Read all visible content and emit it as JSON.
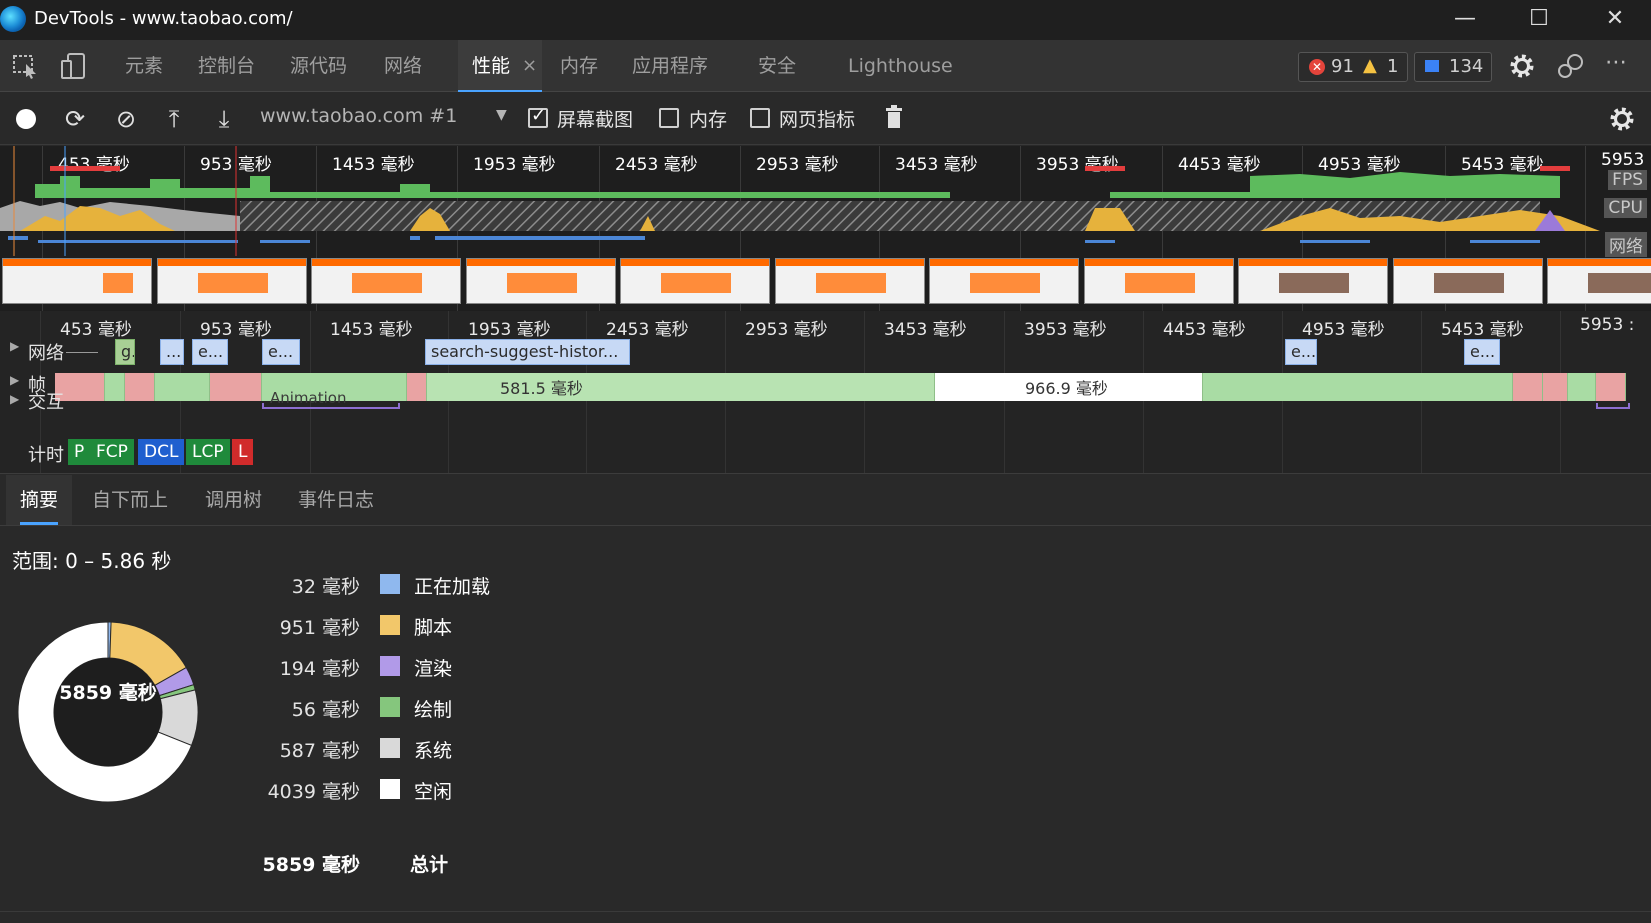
{
  "window": {
    "title": "DevTools - www.taobao.com/",
    "minimize": "—",
    "maximize": "☐",
    "close": "✕"
  },
  "tabs": {
    "items": [
      {
        "label": "元素"
      },
      {
        "label": "控制台"
      },
      {
        "label": "源代码"
      },
      {
        "label": "网络"
      },
      {
        "label": "性能"
      },
      {
        "label": "内存"
      },
      {
        "label": "应用程序"
      },
      {
        "label": "安全"
      },
      {
        "label": "Lighthouse"
      }
    ],
    "active_close": "×",
    "errors": "91",
    "warnings": "1",
    "messages": "134"
  },
  "toolbar": {
    "profile_select": "www.taobao.com #1",
    "screenshots_label": "屏幕截图",
    "screenshots_checked": true,
    "memory_label": "内存",
    "memory_checked": false,
    "web_vitals_label": "网页指标",
    "web_vitals_checked": false
  },
  "overview": {
    "ticks": [
      "453 毫秒",
      "953 毫秒",
      "1453 毫秒",
      "1953 毫秒",
      "2453 毫秒",
      "2953 毫秒",
      "3453 毫秒",
      "3953 毫秒",
      "4453 毫秒",
      "4953 毫秒",
      "5453 毫秒",
      "5953"
    ],
    "fps_label": "FPS",
    "cpu_label": "CPU",
    "net_label": "网络"
  },
  "timeline": {
    "ticks": [
      "453 毫秒",
      "953 毫秒",
      "1453 毫秒",
      "1953 毫秒",
      "2453 毫秒",
      "2953 毫秒",
      "3453 毫秒",
      "3953 毫秒",
      "4453 毫秒",
      "4953 毫秒",
      "5453 毫秒",
      "5953 :"
    ],
    "network_label": "网络",
    "frames_label": "帧",
    "interactions_label": "交互",
    "timings_label": "计时",
    "network_requests": [
      "g...",
      "...",
      "e...",
      "e...",
      "search-suggest-histor...",
      "e...",
      "e..."
    ],
    "frame_1": "581.5 毫秒",
    "frame_2": "966.9 毫秒",
    "animation_label": "Animation",
    "timing_badges": [
      "P",
      "FCP",
      "DCL",
      "LCP",
      "L"
    ]
  },
  "bottom": {
    "tabs": [
      "摘要",
      "自下而上",
      "调用树",
      "事件日志"
    ],
    "range": "范围: 0 – 5.86 秒",
    "donut_total": "5859 毫秒",
    "legend": [
      {
        "value": "32 毫秒",
        "name": "正在加载",
        "color": "#8fb8ee",
        "ms": 32
      },
      {
        "value": "951 毫秒",
        "name": "脚本",
        "color": "#f2c76a",
        "ms": 951
      },
      {
        "value": "194 毫秒",
        "name": "渲染",
        "color": "#b19ae8",
        "ms": 194
      },
      {
        "value": "56 毫秒",
        "name": "绘制",
        "color": "#85c67d",
        "ms": 56
      },
      {
        "value": "587 毫秒",
        "name": "系统",
        "color": "#d9d9d9",
        "ms": 587
      },
      {
        "value": "4039 毫秒",
        "name": "空闲",
        "color": "#ffffff",
        "ms": 4039
      }
    ],
    "total_value": "5859 毫秒",
    "total_label": "总计"
  }
}
